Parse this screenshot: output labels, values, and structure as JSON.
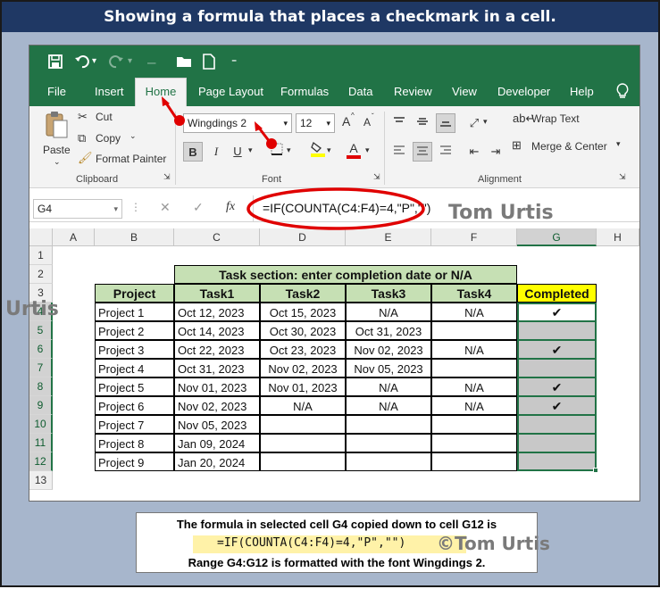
{
  "title": "Showing a formula that places a checkmark in a cell.",
  "qat": {
    "save_icon": "save-icon",
    "undo_icon": "undo-icon",
    "redo_icon": "redo-icon",
    "open_icon": "folder-open-icon",
    "new_icon": "new-document-icon",
    "more_icon": "customize-icon"
  },
  "tabs": [
    "File",
    "Insert",
    "Home",
    "Page Layout",
    "Formulas",
    "Data",
    "Review",
    "View",
    "Developer",
    "Help"
  ],
  "ribbon": {
    "paste": "Paste",
    "cut": "Cut",
    "copy": "Copy",
    "format_painter": "Format Painter",
    "clipboard_group": "Clipboard",
    "font_name": "Wingdings 2",
    "font_size": "12",
    "font_group": "Font",
    "bold": "B",
    "italic": "I",
    "underline": "U",
    "wrap_text": "Wrap Text",
    "merge_center": "Merge & Center",
    "alignment_group": "Alignment",
    "grow_font": "A",
    "shrink_font": "A",
    "font_color_letter": "A"
  },
  "formula_bar": {
    "name_box": "G4",
    "fx": "fx",
    "formula": "=IF(COUNTA(C4:F4)=4,\"P\",\"\")"
  },
  "watermark": "Tom Urtis",
  "watermark_copy": "©Tom Urtis",
  "watermark_side": "Urtis",
  "columns": [
    "A",
    "B",
    "C",
    "D",
    "E",
    "F",
    "G",
    "H"
  ],
  "rows": [
    "1",
    "2",
    "3",
    "4",
    "5",
    "6",
    "7",
    "8",
    "9",
    "10",
    "11",
    "12",
    "13"
  ],
  "sheet": {
    "task_section_header": "Task section: enter completion date or N/A",
    "headers": [
      "Project",
      "Task1",
      "Task2",
      "Task3",
      "Task4",
      "Completed"
    ],
    "data": [
      [
        "Project 1",
        "Oct 12, 2023",
        "Oct 15, 2023",
        "N/A",
        "N/A",
        "✔"
      ],
      [
        "Project 2",
        "Oct 14, 2023",
        "Oct 30, 2023",
        "Oct 31, 2023",
        "",
        ""
      ],
      [
        "Project 3",
        "Oct 22, 2023",
        "Oct 23, 2023",
        "Nov 02, 2023",
        "N/A",
        "✔"
      ],
      [
        "Project 4",
        "Oct 31, 2023",
        "Nov 02, 2023",
        "Nov 05, 2023",
        "",
        ""
      ],
      [
        "Project 5",
        "Nov 01, 2023",
        "Nov 01, 2023",
        "N/A",
        "N/A",
        "✔"
      ],
      [
        "Project 6",
        "Nov 02, 2023",
        "N/A",
        "N/A",
        "N/A",
        "✔"
      ],
      [
        "Project 7",
        "Nov 05, 2023",
        "",
        "",
        "",
        ""
      ],
      [
        "Project 8",
        "Jan 09, 2024",
        "",
        "",
        "",
        ""
      ],
      [
        "Project 9",
        "Jan 20, 2024",
        "",
        "",
        "",
        ""
      ]
    ]
  },
  "bottom_note": {
    "line1": "The formula in selected cell G4 copied down to cell G12 is",
    "formula": "=IF(COUNTA(C4:F4)=4,\"P\",\"\")",
    "line3": "Range G4:G12 is formatted with the font Wingdings 2."
  },
  "colors": {
    "excel_green": "#217346",
    "header_green": "#c6e0b4",
    "completed_yellow": "#ffff00",
    "selection_gray": "#c8c8c8",
    "annotation_red": "#e00000"
  }
}
